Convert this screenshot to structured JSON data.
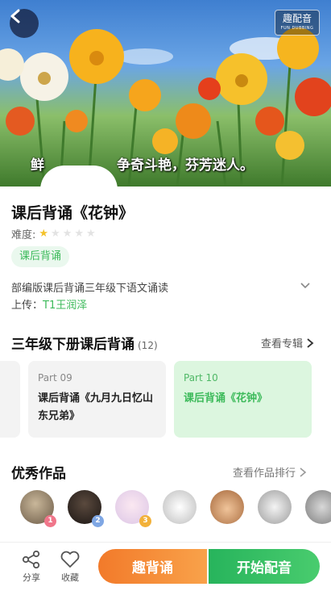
{
  "hero": {
    "dub_badge_main": "趣配音",
    "dub_badge_sub": "FUN DUBBING",
    "subtitle_left": "鲜",
    "subtitle_right": "争奇斗艳，芬芳迷人。"
  },
  "lesson": {
    "title": "课后背诵《花钟》",
    "difficulty_label": "难度:",
    "difficulty_stars": 0.5,
    "tag": "课后背诵",
    "description": "部编版课后背诵三年级下语文诵读",
    "uploader_label": "上传：",
    "uploader_name": "T1王润泽"
  },
  "album": {
    "title": "三年级下册课后背诵",
    "count": "(12)",
    "link": "查看专辑",
    "cards": [
      {
        "part": "Part 09",
        "title": "课后背诵《九月九日忆山东兄弟》"
      },
      {
        "part": "Part 10",
        "title": "课后背诵《花钟》"
      }
    ]
  },
  "works": {
    "title": "优秀作品",
    "link": "查看作品排行",
    "ranks": [
      "1",
      "2",
      "3"
    ]
  },
  "bottom": {
    "share": "分享",
    "favorite": "收藏",
    "fun_recite": "趣背诵",
    "start_dub": "开始配音"
  },
  "colors": {
    "accent_green": "#3cba5a",
    "accent_orange": "#f27a2a"
  }
}
